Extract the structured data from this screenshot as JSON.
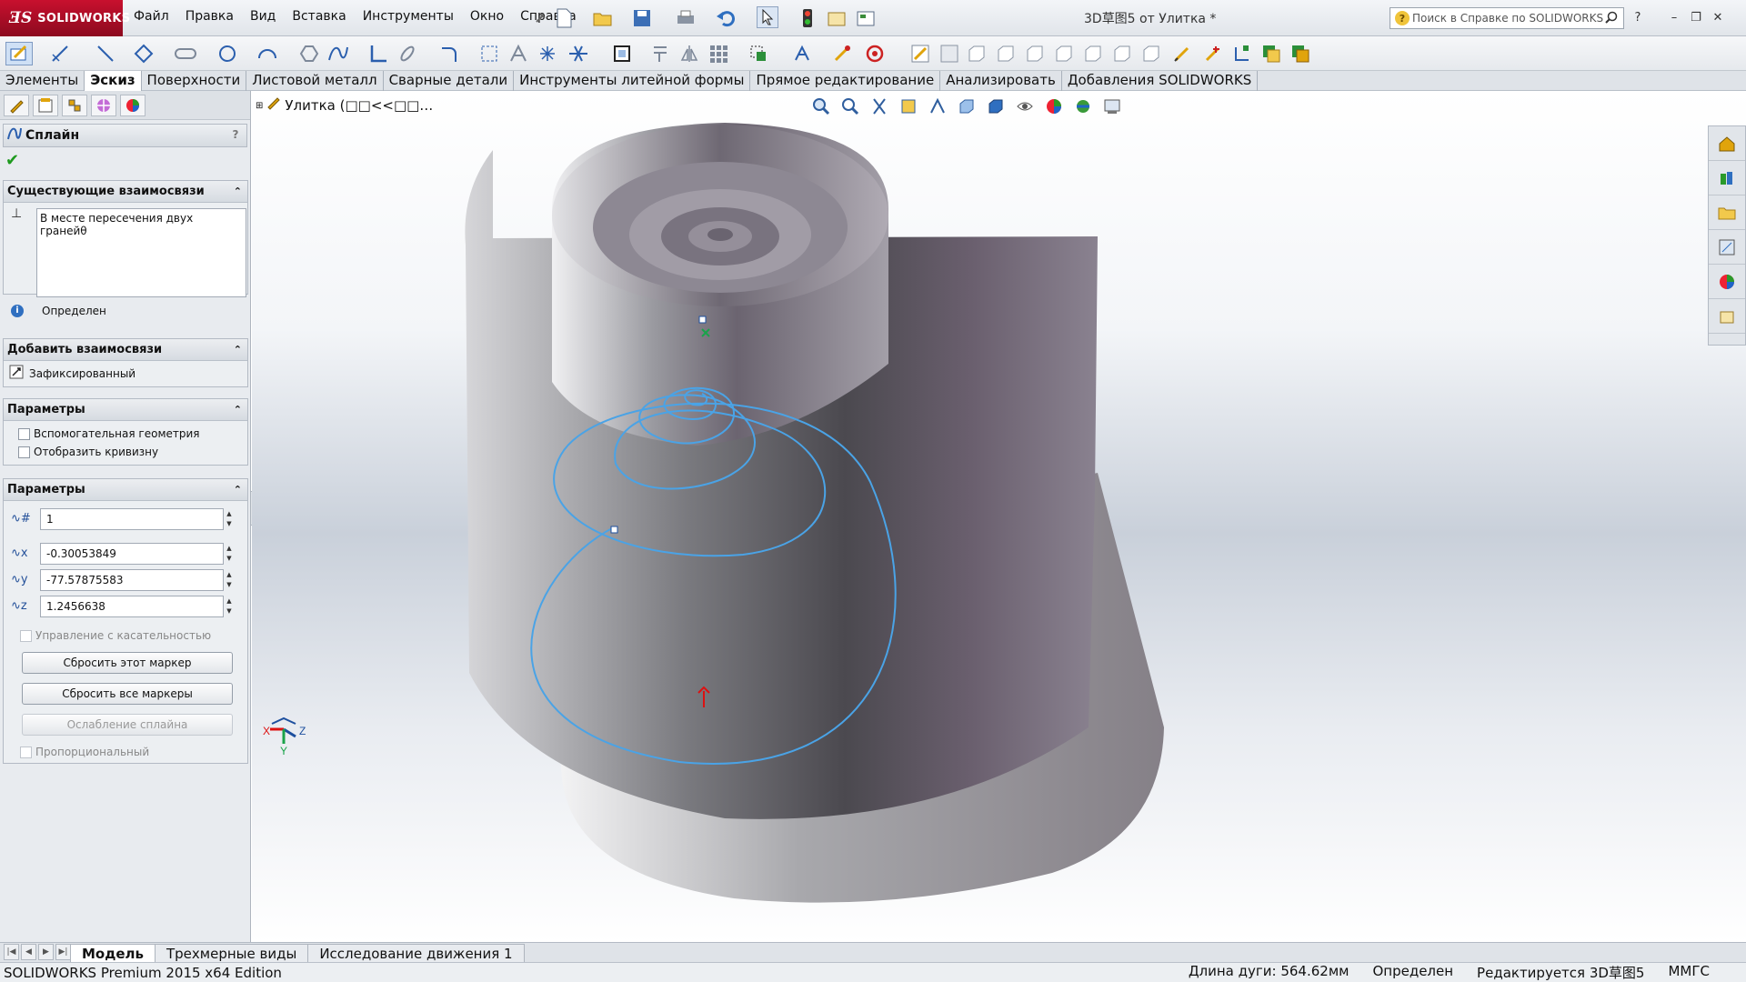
{
  "app": {
    "logo_text": "SOLIDWORKS",
    "document_title": "3D草图5 от Улитка *",
    "help_search_placeholder": "Поиск в Справке по SOLIDWORKS"
  },
  "menu": [
    "Файл",
    "Правка",
    "Вид",
    "Вставка",
    "Инструменты",
    "Окно",
    "Справка"
  ],
  "command_tabs": [
    {
      "label": "Элементы",
      "active": false
    },
    {
      "label": "Эскиз",
      "active": true
    },
    {
      "label": "Поверхности",
      "active": false
    },
    {
      "label": "Листовой металл",
      "active": false
    },
    {
      "label": "Сварные детали",
      "active": false
    },
    {
      "label": "Инструменты литейной формы",
      "active": false
    },
    {
      "label": "Прямое редактирование",
      "active": false
    },
    {
      "label": "Анализировать",
      "active": false
    },
    {
      "label": "Добавления SOLIDWORKS",
      "active": false
    }
  ],
  "property_manager": {
    "title": "Сплайн",
    "existing_relations": {
      "header": "Существующие взаимосвязи",
      "item": "В месте пересечения двух гранейθ",
      "status": "Определен"
    },
    "add_relations": {
      "header": "Добавить взаимосвязи",
      "item": "Зафиксированный"
    },
    "options": {
      "header": "Параметры",
      "checkbox1": "Вспомогательная геометрия",
      "checkbox2": "Отобразить кривизну"
    },
    "parameters": {
      "header": "Параметры",
      "point_number": "1",
      "x": "-0.30053849",
      "y": "-77.57875583",
      "z": "1.2456638",
      "tangency_label": "Управление с касательностью",
      "reset_this": "Сбросить этот маркер",
      "reset_all": "Сбросить все маркеры",
      "relax": "Ослабление сплайна",
      "proportional": "Пропорциональный"
    }
  },
  "viewport": {
    "tree_title": "Улитка (□□<<□□…"
  },
  "bottom_tabs": [
    {
      "label": "Модель",
      "active": true
    },
    {
      "label": "Трехмерные виды",
      "active": false
    },
    {
      "label": "Исследование движения 1",
      "active": false
    }
  ],
  "status": {
    "left": "SOLIDWORKS Premium 2015 x64 Edition",
    "arc_length": "Длина дуги: 564.62мм",
    "defined": "Определен",
    "editing": "Редактируется 3D草图5",
    "units": "MMГС"
  },
  "colors": {
    "spline": "#4aa3e6",
    "brand": "#c8102e"
  }
}
